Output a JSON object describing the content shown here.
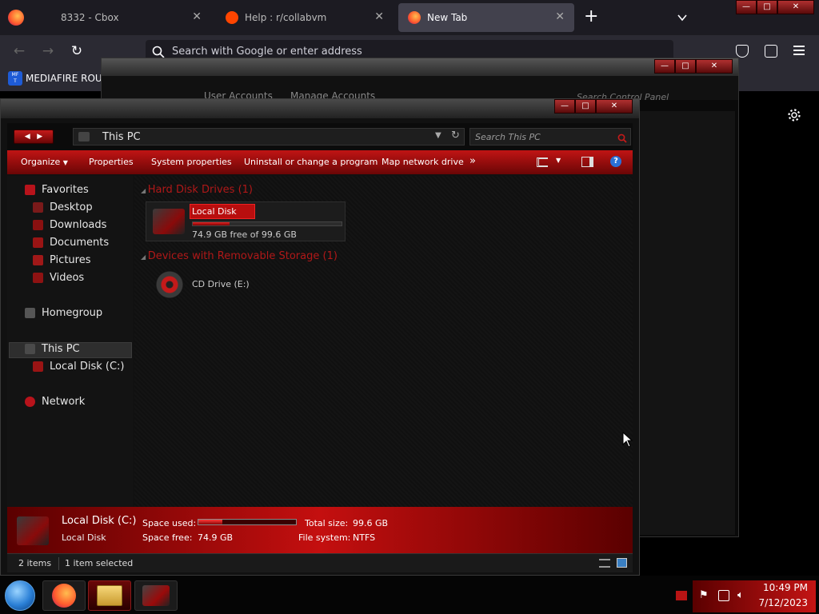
{
  "browser": {
    "tabs": [
      {
        "title": "8332 - Cbox",
        "active": false
      },
      {
        "title": "Help : r/collabvm",
        "active": false
      },
      {
        "title": "New Tab",
        "active": true
      }
    ],
    "new_tab_icon": "+",
    "tab_list_icon": "chevron-down-icon",
    "url_placeholder": "Search with Google or enter address",
    "bookmark": "MEDIAFIRE ROULI",
    "bookmark_icon_text": "MF\nT",
    "settings_icon": "gear-icon"
  },
  "control_panel": {
    "breadcrumb": [
      "User Accounts",
      "Manage Accounts"
    ],
    "search_placeholder": "Search Control Panel"
  },
  "explorer": {
    "address": "This PC",
    "search_placeholder": "Search This PC",
    "toolbar": {
      "organize": "Organize",
      "properties": "Properties",
      "system_properties": "System properties",
      "uninstall": "Uninstall or change a program",
      "map_drive": "Map network drive",
      "more": "»"
    },
    "nav": {
      "favorites": "Favorites",
      "favorites_items": [
        "Desktop",
        "Downloads",
        "Documents",
        "Pictures",
        "Videos"
      ],
      "homegroup": "Homegroup",
      "this_pc": "This PC",
      "local_disk": "Local Disk (C:)",
      "network": "Network"
    },
    "groups": {
      "hdd": "Hard Disk Drives (1)",
      "removable": "Devices with Removable Storage (1)"
    },
    "drive_c": {
      "rename_value": "Local Disk",
      "free_text": "74.9 GB free of 99.6 GB",
      "used_fraction": 0.248
    },
    "drive_e": {
      "label": "CD Drive (E:)"
    },
    "details": {
      "name": "Local Disk (C:)",
      "type": "Local Disk",
      "space_used_label": "Space used:",
      "space_free_label": "Space free:",
      "space_free_value": "74.9 GB",
      "total_size_label": "Total size:",
      "total_size_value": "99.6 GB",
      "file_system_label": "File system:",
      "file_system_value": "NTFS"
    },
    "status": {
      "items": "2 items",
      "selected": "1 item selected"
    }
  },
  "taskbar": {
    "time": "10:49 PM",
    "date": "7/12/2023"
  },
  "colors": {
    "accent_red": "#c40f0f",
    "firefox_bg": "#1c1b22",
    "firefox_toolbar": "#2b2a33"
  }
}
